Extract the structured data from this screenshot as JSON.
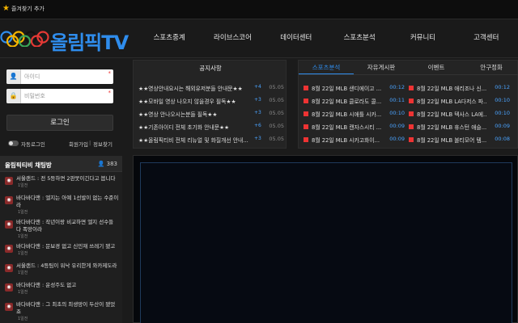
{
  "topbar": {
    "favorite_label": "즐겨찾기 추가"
  },
  "brand": {
    "logo_text": "올림픽TV",
    "ring_colors": [
      "#2f8ded",
      "#f4b400",
      "#111111",
      "#3aa757",
      "#e53935"
    ]
  },
  "nav": {
    "items": [
      {
        "label": "스포츠중계"
      },
      {
        "label": "라이브스코어"
      },
      {
        "label": "데이터센터"
      },
      {
        "label": "스포츠분석"
      },
      {
        "label": "커뮤니티"
      },
      {
        "label": "고객센터"
      }
    ]
  },
  "login": {
    "id_placeholder": "아이디",
    "pw_placeholder": "비밀번호",
    "required_mark": "*",
    "button_label": "로그인",
    "auto_login_label": "자동로그인",
    "join_label": "회원가입",
    "separator": "|",
    "find_label": "정보찾기"
  },
  "chat": {
    "title": "올림픽티비 채팅방",
    "count": "383",
    "messages": [
      {
        "text": "서울랜드 : 전 5등하면 2판못이긴다고 봅니다",
        "time": "1일전"
      },
      {
        "text": "바다바다맨 : 엘지는 아예 1선발이 없는 수준이라",
        "time": "1일전"
      },
      {
        "text": "바다바다맨 : 작년이랑 비교하면 엘지 선수들 다 폭망이라",
        "time": "1일전"
      },
      {
        "text": "바다바다맨 : 문보경 없고 신민재 쓰레기 됐고",
        "time": "1일전"
      },
      {
        "text": "서울랜드 : 4등팀이 워낙 유리한게 와카제도라",
        "time": "1일전"
      },
      {
        "text": "바다바다맨 : 운성주도 없고",
        "time": "1일전"
      },
      {
        "text": "바다바다맨 : 그 최초의 최생망이 두산이 됐었죠",
        "time": "1일전"
      }
    ]
  },
  "notice": {
    "title": "공지사항",
    "items": [
      {
        "text": "★★영상안내요시는 해외유저분들 안내문★★",
        "count": "+4",
        "date": "05.05"
      },
      {
        "text": "★★모바일 영상 나오지 않을경우 필독★★",
        "count": "+3",
        "date": "05.05"
      },
      {
        "text": "★★영상 안나오시는분들 필독★★",
        "count": "+3",
        "date": "05.05"
      },
      {
        "text": "★★기존아이디 전체 초기화 안내문★★",
        "count": "+6",
        "date": "05.05"
      },
      {
        "text": "★★올림픽티비 전체 리뉴얼 및 화질개선 안내...",
        "count": "+3",
        "date": "05.05"
      }
    ]
  },
  "board": {
    "tabs": [
      {
        "label": "스포츠분석",
        "active": true
      },
      {
        "label": "자유게시판"
      },
      {
        "label": "이벤트"
      },
      {
        "label": "안구정화"
      }
    ],
    "rows": [
      [
        {
          "text": "8월 22일 MLB 샌디에이고 ...",
          "time": "00:12"
        },
        {
          "text": "8월 22일 MLB 애리조나 신...",
          "time": "00:12"
        }
      ],
      [
        {
          "text": "8월 22일 MLB 클로라도 콜...",
          "time": "00:11"
        },
        {
          "text": "8월 22일 MLB LA다저스 파...",
          "time": "00:10"
        }
      ],
      [
        {
          "text": "8월 22일 MLB 시애틀 시카...",
          "time": "00:10"
        },
        {
          "text": "8월 22일 MLB 텍사스 LA에...",
          "time": "00:10"
        }
      ],
      [
        {
          "text": "8월 22일 MLB 캔자스시티 ...",
          "time": "00:09"
        },
        {
          "text": "8월 22일 MLB 휴스턴 애슬...",
          "time": "00:09"
        }
      ],
      [
        {
          "text": "8월 22일 MLB 시카고화이...",
          "time": "00:09"
        },
        {
          "text": "8월 22일 MLB 볼티모어 템...",
          "time": "00:08"
        }
      ]
    ]
  }
}
